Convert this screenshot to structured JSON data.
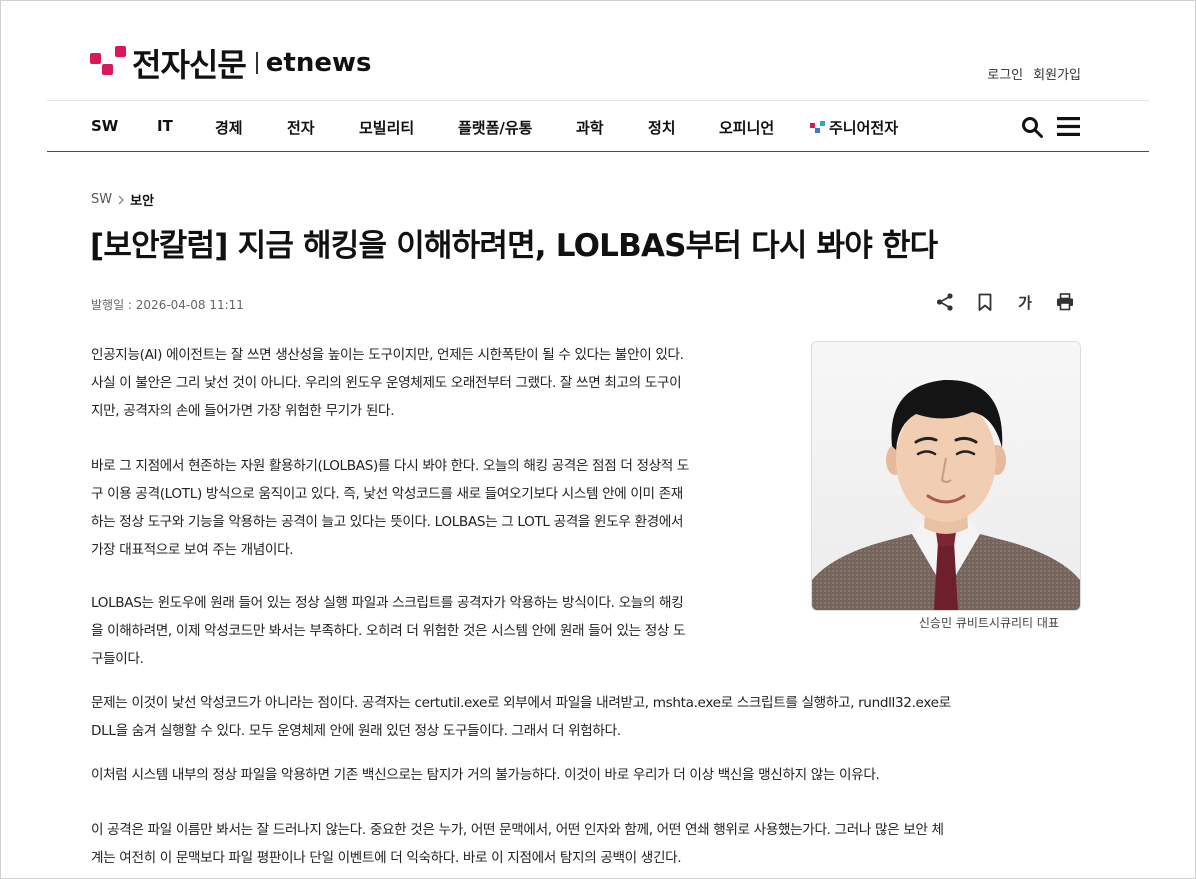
{
  "header": {
    "logo_ko": "전자신문",
    "logo_en": "etnews",
    "login": "로그인",
    "signup": "회원가입"
  },
  "nav": {
    "items": [
      "SW",
      "IT",
      "경제",
      "전자",
      "모빌리티",
      "플랫폼/유통",
      "과학",
      "정치",
      "오피니언",
      "주니어전자"
    ],
    "search_icon": "search-icon",
    "menu_icon": "hamburger-menu-icon"
  },
  "article": {
    "breadcrumb": [
      "SW",
      "보안"
    ],
    "headline": "[보안칼럼] 지금 해킹을 이해하려면, LOLBAS부터 다시 봐야 한다",
    "pubdate": "발행일 : 2026-04-08 11:11",
    "tools": {
      "share_icon": "share-icon",
      "bookmark_icon": "bookmark-icon",
      "font_size_label": "가",
      "print_icon": "print-icon"
    },
    "paragraphs": [
      [
        "인공지능(AI) 에이전트는 잘 쓰면 생산성을 높이는 도구이지만, 언제든 시한폭탄이 될 수 있다는 불안이 있다.",
        "사실 이 불안은 그리 낯선 것이 아니다. 우리의 윈도우 운영체제도 오래전부터 그랬다. 잘 쓰면 최고의 도구이",
        "지만, 공격자의 손에 들어가면 가장 위험한 무기가 된다."
      ],
      [
        "바로 그 지점에서 현존하는 자원 활용하기(LOLBAS)를 다시 봐야 한다. 오늘의 해킹 공격은 점점 더 정상적 도",
        "구 이용 공격(LOTL) 방식으로 움직이고 있다. 즉, 낯선 악성코드를 새로 들여오기보다 시스템 안에 이미 존재",
        "하는 정상 도구와 기능을 악용하는 공격이 늘고 있다는 뜻이다. LOLBAS는 그 LOTL 공격을 윈도우 환경에서",
        "가장 대표적으로 보여 주는 개념이다."
      ],
      [
        "LOLBAS는 윈도우에 원래 들어 있는 정상 실행 파일과 스크립트를 공격자가 악용하는 방식이다. 오늘의 해킹",
        "을 이해하려면, 이제 악성코드만 봐서는 부족하다. 오히려 더 위험한 것은 시스템 안에 원래 들어 있는 정상 도",
        "구들이다."
      ],
      [
        "문제는 이것이 낯선 악성코드가 아니라는 점이다. 공격자는 certutil.exe로 외부에서 파일을 내려받고, mshta.exe로 스크립트를 실행하고, rundll32.exe로",
        "DLL을 숨겨 실행할 수 있다. 모두 운영체제 안에 원래 있던 정상 도구들이다. 그래서 더 위험하다."
      ],
      [
        "이처럼 시스템 내부의 정상 파일을 악용하면 기존 백신으로는 탐지가 거의 불가능하다. 이것이 바로 우리가 더 이상 백신을 맹신하지 않는 이유다."
      ],
      [
        "이 공격은 파일 이름만 봐서는 잘 드러나지 않는다. 중요한 것은 누가, 어떤 문맥에서, 어떤 인자와 함께, 어떤 연쇄 행위로 사용했는가다. 그러나 많은 보안 체",
        "계는 여전히 이 문맥보다 파일 평판이나 단일 이벤트에 더 익숙하다. 바로 이 지점에서 탐지의 공백이 생긴다."
      ]
    ],
    "photo_caption": "신승민 큐비트시큐리티 대표"
  },
  "colors": {
    "brand": "#d8175c",
    "nav_border": "#8a2c5a"
  }
}
